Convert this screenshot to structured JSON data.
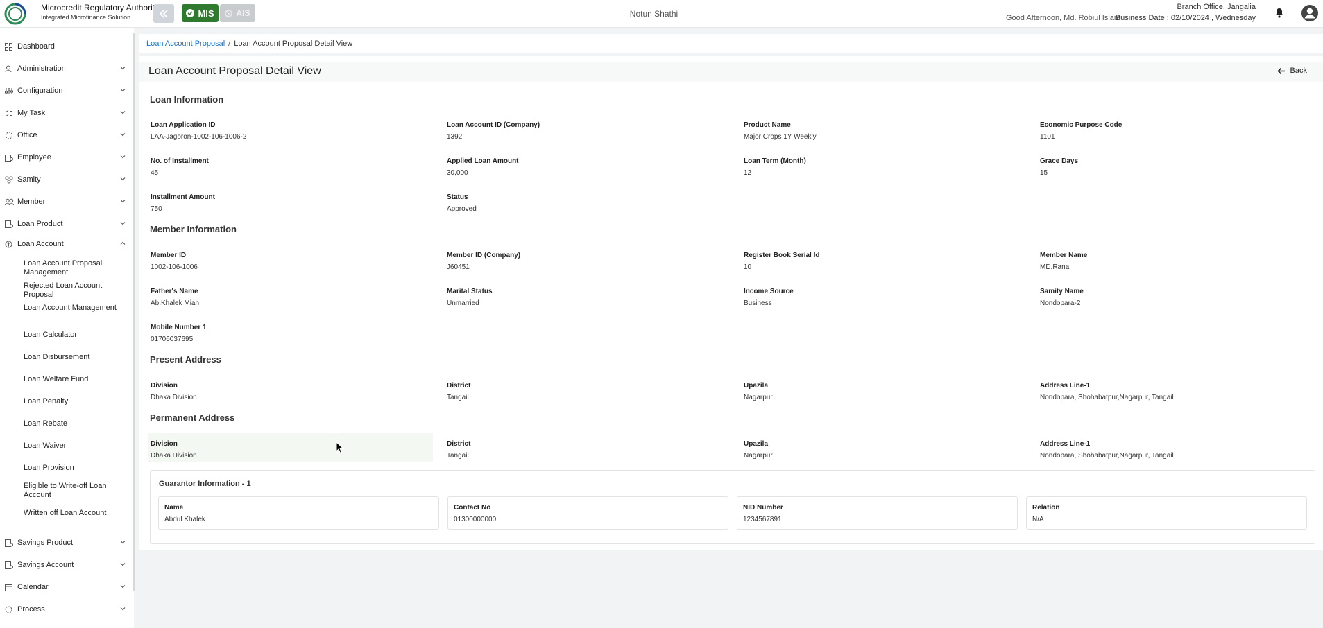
{
  "header": {
    "org_name": "Microcredit Regulatory Authority",
    "org_sub": "Integrated Microfinance Solution",
    "mis_label": "MIS",
    "ais_label": "AIS",
    "org_title": "Notun Shathi",
    "branch": "Branch Office, Jangalia",
    "greeting": "Good Afternoon, Md. Robiul Islam",
    "business_date": "Business Date : 02/10/2024 , Wednesday"
  },
  "sidebar": {
    "items": [
      {
        "label": "Dashboard",
        "icon": "grid-icon"
      },
      {
        "label": "Administration",
        "icon": "admin-icon"
      },
      {
        "label": "Configuration",
        "icon": "sliders-icon"
      },
      {
        "label": "My Task",
        "icon": "task-icon"
      },
      {
        "label": "Office",
        "icon": "office-icon"
      },
      {
        "label": "Employee",
        "icon": "employee-icon"
      },
      {
        "label": "Samity",
        "icon": "samity-icon"
      },
      {
        "label": "Member",
        "icon": "member-icon"
      },
      {
        "label": "Loan Product",
        "icon": "loan-product-icon"
      },
      {
        "label": "Loan Account",
        "icon": "loan-account-icon"
      }
    ],
    "sub_items": [
      "Loan Account Proposal Management",
      "Rejected Loan Account Proposal",
      "Loan Account Management",
      "Loan Calculator",
      "Loan Disbursement",
      "Loan Welfare Fund",
      "Loan Penalty",
      "Loan Rebate",
      "Loan Waiver",
      "Loan Provision",
      "Eligible to Write-off Loan Account",
      "Written off Loan Account"
    ],
    "bottom_items": [
      {
        "label": "Savings Product",
        "icon": "savings-product-icon"
      },
      {
        "label": "Savings Account",
        "icon": "savings-account-icon"
      },
      {
        "label": "Calendar",
        "icon": "calendar-icon"
      },
      {
        "label": "Process",
        "icon": "process-icon"
      }
    ]
  },
  "breadcrumb": {
    "parent": "Loan Account Proposal",
    "separator": "/",
    "current": "Loan Account Proposal Detail View"
  },
  "page": {
    "title": "Loan Account Proposal Detail View",
    "back_label": "Back"
  },
  "sections": {
    "loan_info": {
      "title": "Loan Information",
      "fields": [
        {
          "label": "Loan Application ID",
          "value": "LAA-Jagoron-1002-106-1006-2"
        },
        {
          "label": "Loan Account ID (Company)",
          "value": "1392"
        },
        {
          "label": "Product Name",
          "value": "Major Crops 1Y Weekly"
        },
        {
          "label": "Economic Purpose Code",
          "value": "1101"
        },
        {
          "label": "No. of Installment",
          "value": "45"
        },
        {
          "label": "Applied Loan Amount",
          "value": "30,000"
        },
        {
          "label": "Loan Term (Month)",
          "value": "12"
        },
        {
          "label": "Grace Days",
          "value": "15"
        },
        {
          "label": "Installment Amount",
          "value": "750"
        },
        {
          "label": "Status",
          "value": "Approved"
        }
      ]
    },
    "member_info": {
      "title": "Member Information",
      "fields": [
        {
          "label": "Member ID",
          "value": "1002-106-1006"
        },
        {
          "label": "Member ID (Company)",
          "value": "J60451"
        },
        {
          "label": "Register Book Serial Id",
          "value": "10"
        },
        {
          "label": "Member Name",
          "value": "MD.Rana"
        },
        {
          "label": "Father's Name",
          "value": "Ab.Khalek Miah"
        },
        {
          "label": "Marital Status",
          "value": "Unmarried"
        },
        {
          "label": "Income Source",
          "value": "Business"
        },
        {
          "label": "Samity Name",
          "value": "Nondopara-2"
        },
        {
          "label": "Mobile Number 1",
          "value": "01706037695"
        }
      ]
    },
    "present_address": {
      "title": "Present Address",
      "fields": [
        {
          "label": "Division",
          "value": "Dhaka Division"
        },
        {
          "label": "District",
          "value": "Tangail"
        },
        {
          "label": "Upazila",
          "value": "Nagarpur"
        },
        {
          "label": "Address Line-1",
          "value": "Nondopara, Shohabatpur,Nagarpur, Tangail"
        }
      ]
    },
    "permanent_address": {
      "title": "Permanent Address",
      "fields": [
        {
          "label": "Division",
          "value": "Dhaka Division"
        },
        {
          "label": "District",
          "value": "Tangail"
        },
        {
          "label": "Upazila",
          "value": "Nagarpur"
        },
        {
          "label": "Address Line-1",
          "value": "Nondopara, Shohabatpur,Nagarpur, Tangail"
        }
      ]
    },
    "guarantor": {
      "title": "Guarantor Information - 1",
      "fields": [
        {
          "label": "Name",
          "value": "Abdul Khalek"
        },
        {
          "label": "Contact No",
          "value": "01300000000"
        },
        {
          "label": "NID Number",
          "value": "1234567891"
        },
        {
          "label": "Relation",
          "value": "N/A"
        }
      ]
    }
  },
  "colors": {
    "accent_green": "#2f7a2f",
    "link_blue": "#1a73c8"
  }
}
